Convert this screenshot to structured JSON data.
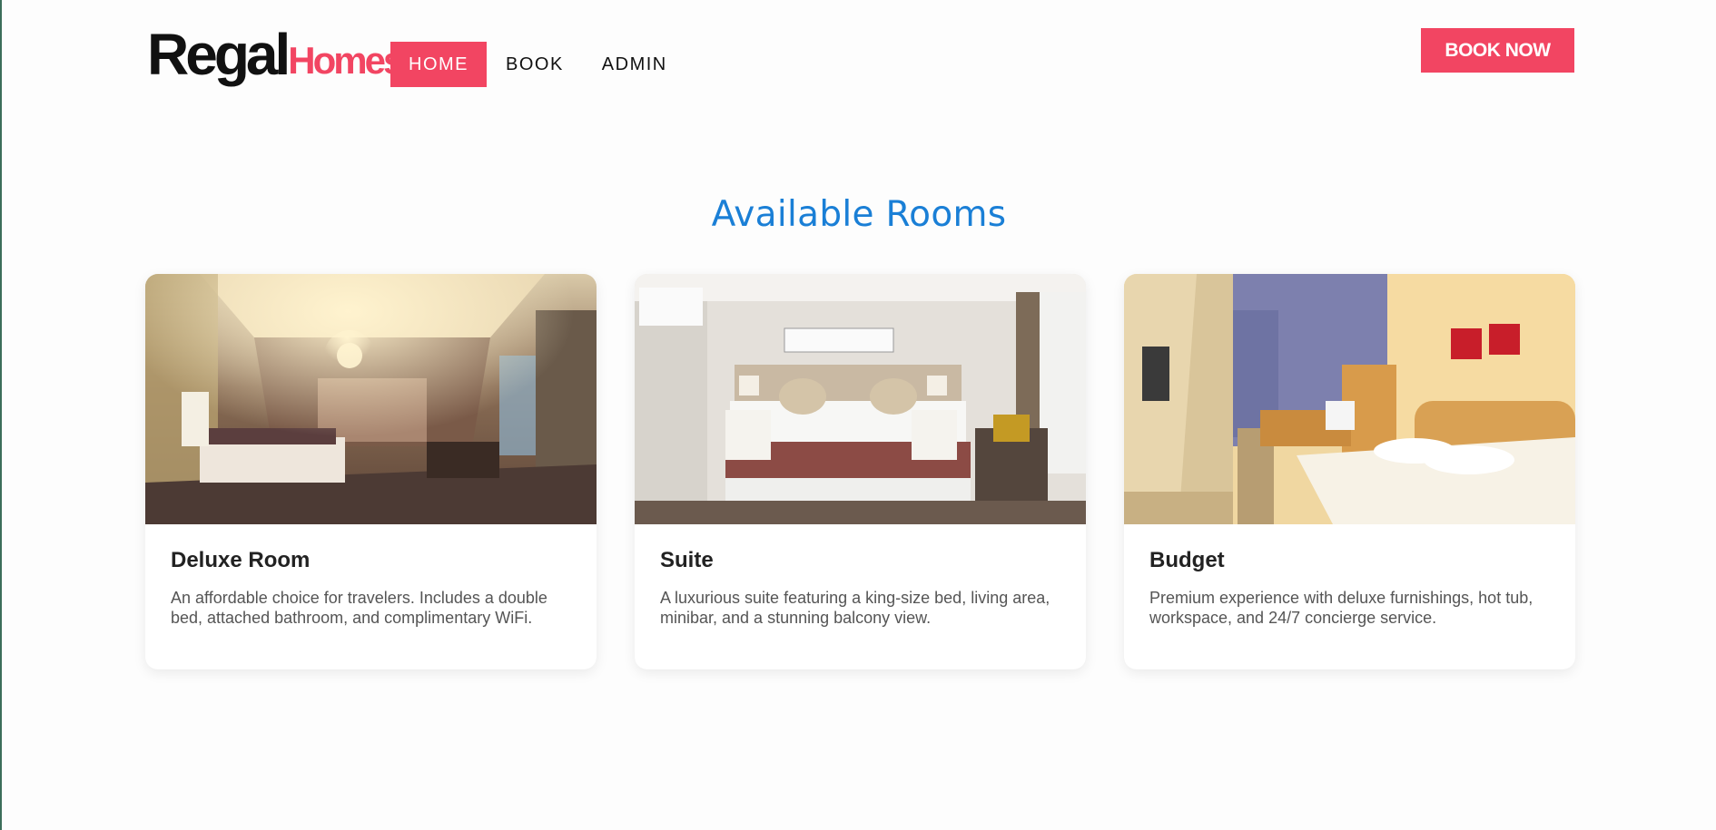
{
  "brand": {
    "part1": "Regal",
    "part2": "Homes",
    "accent": "#f24562"
  },
  "nav": {
    "items": [
      {
        "label": "HOME",
        "active": true
      },
      {
        "label": "BOOK",
        "active": false
      },
      {
        "label": "ADMIN",
        "active": false
      }
    ]
  },
  "header": {
    "book_now_label": "BOOK NOW"
  },
  "main": {
    "title": "Available Rooms",
    "title_color": "#1a7fd6",
    "rooms": [
      {
        "name": "Deluxe Room",
        "description": "An affordable choice for travelers. Includes a double bed, attached bathroom, and complimentary WiFi.",
        "image": "luxury-bedroom-photo"
      },
      {
        "name": "Suite",
        "description": "A luxurious suite featuring a king-size bed, living area, minibar, and a stunning balcony view.",
        "image": "white-bedroom-photo"
      },
      {
        "name": "Budget",
        "description": "Premium experience with deluxe furnishings, hot tub, workspace, and 24/7 concierge service.",
        "image": "hotel-room-photo"
      }
    ]
  }
}
